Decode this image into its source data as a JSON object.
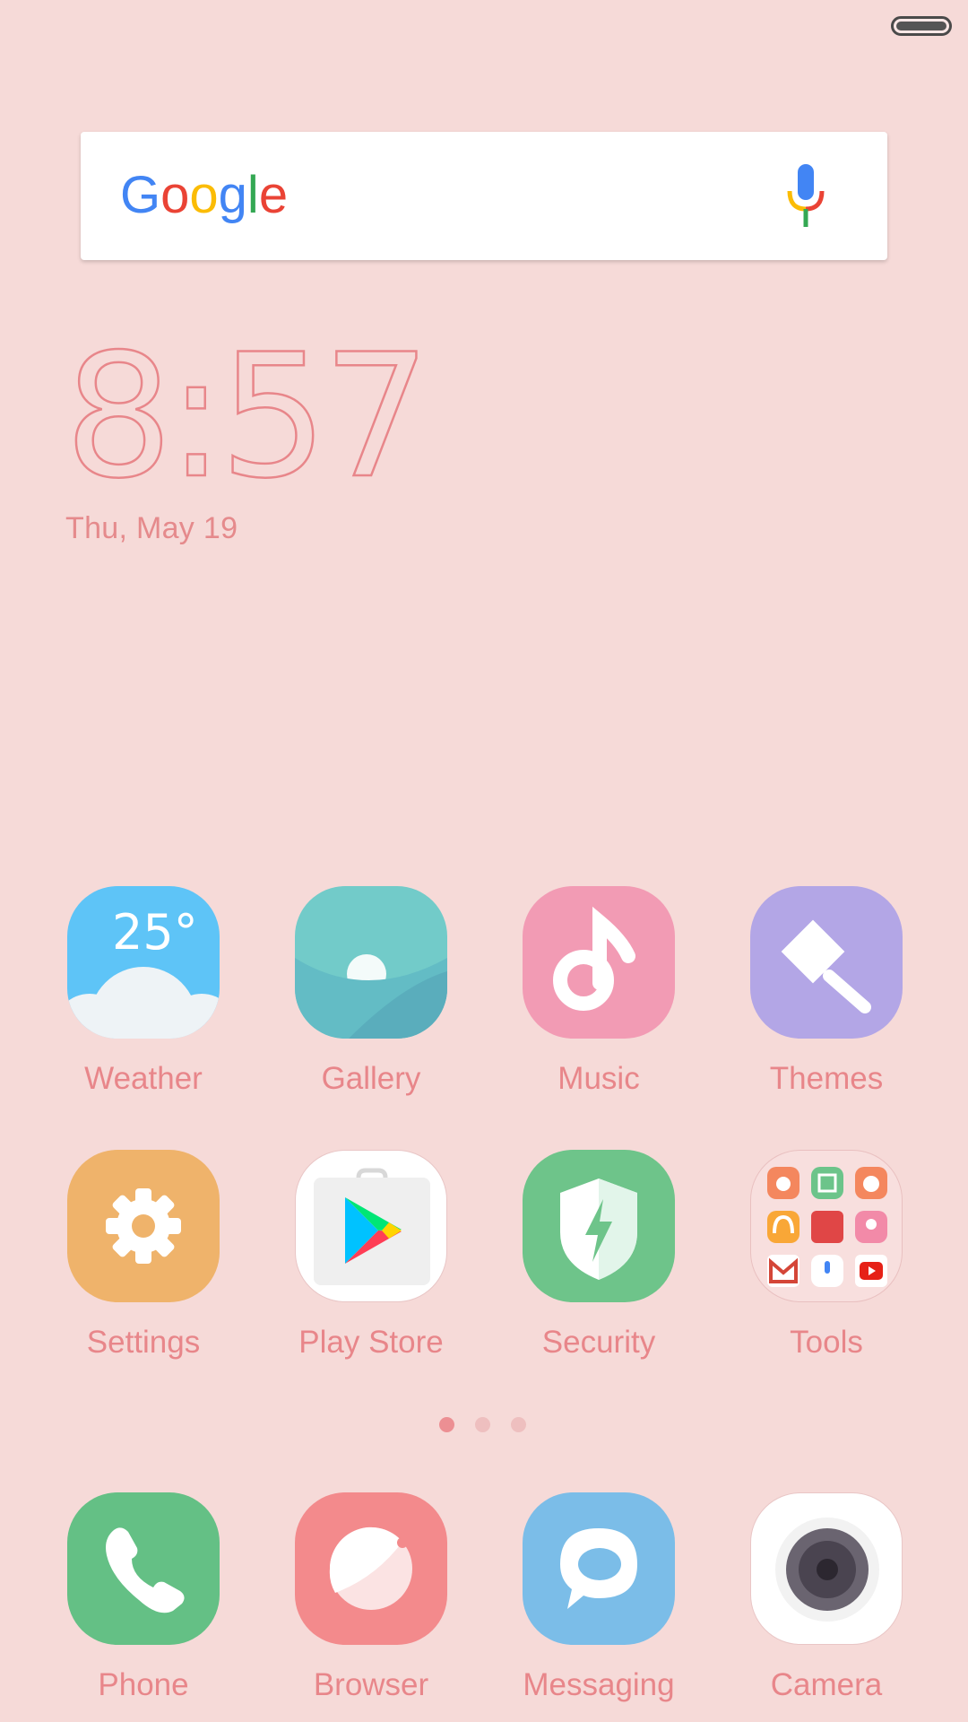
{
  "status_bar": {
    "battery_icon": "battery-icon"
  },
  "search": {
    "logo_text": "Google",
    "mic_icon": "microphone-icon"
  },
  "clock": {
    "time": "8:57",
    "date": "Thu, May 19"
  },
  "weather_widget": {
    "temperature": "25°"
  },
  "apps_row1": [
    {
      "label": "Weather",
      "icon": "weather-icon",
      "color": "#5ec4f7"
    },
    {
      "label": "Gallery",
      "icon": "gallery-icon",
      "color": "#6ec9c7"
    },
    {
      "label": "Music",
      "icon": "music-icon",
      "color": "#f29bb4"
    },
    {
      "label": "Themes",
      "icon": "themes-icon",
      "color": "#b3a6e6"
    }
  ],
  "apps_row2": [
    {
      "label": "Settings",
      "icon": "settings-icon",
      "color": "#efb36b"
    },
    {
      "label": "Play Store",
      "icon": "play-store-icon",
      "color": "#ffffff"
    },
    {
      "label": "Security",
      "icon": "security-icon",
      "color": "#6ec48a"
    },
    {
      "label": "Tools",
      "icon": "tools-folder-icon",
      "color": "#f8dfde"
    }
  ],
  "page_indicator": {
    "pages": 3,
    "current": 1
  },
  "dock": [
    {
      "label": "Phone",
      "icon": "phone-icon",
      "color": "#64c085"
    },
    {
      "label": "Browser",
      "icon": "browser-icon",
      "color": "#f38a8c"
    },
    {
      "label": "Messaging",
      "icon": "messaging-icon",
      "color": "#7bbde8"
    },
    {
      "label": "Camera",
      "icon": "camera-icon",
      "color": "#ffffff"
    }
  ],
  "colors": {
    "wallpaper": "#f6dad8",
    "accent_text": "#e8868a"
  }
}
